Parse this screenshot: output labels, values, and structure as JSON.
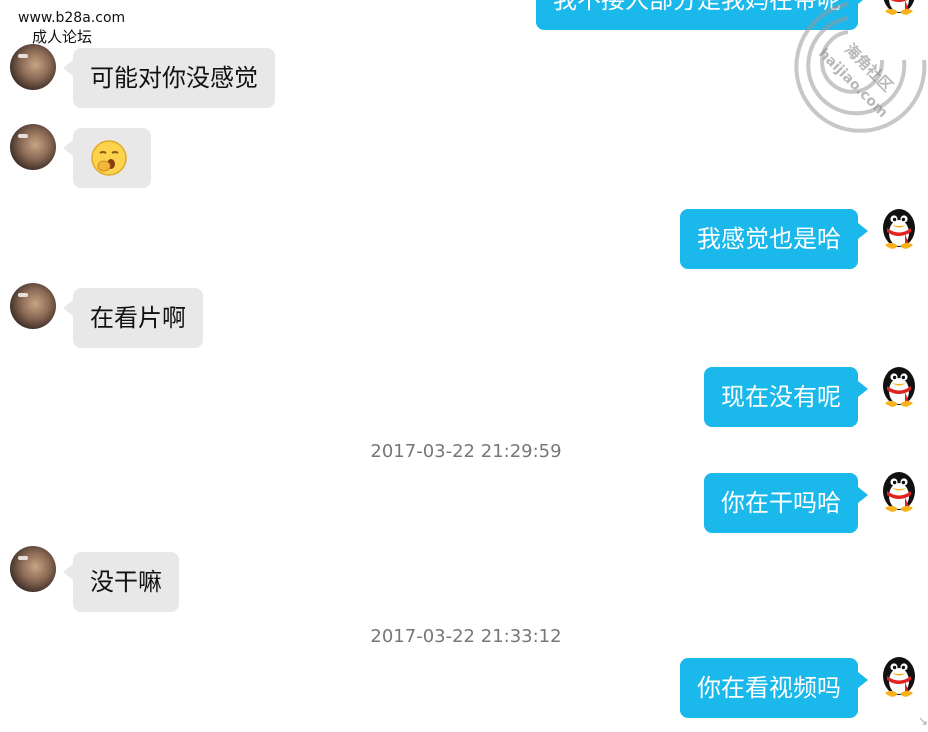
{
  "header": {
    "site_url": "www.b28a.com",
    "site_subtitle": "成人论坛"
  },
  "watermark": {
    "text_cn": "海角社区",
    "text_url": "haijiao.com"
  },
  "messages": [
    {
      "side": "right",
      "text": "我不接人部分是我妈在带呢"
    },
    {
      "side": "left",
      "text": "可能对你没感觉"
    },
    {
      "side": "left",
      "text": "",
      "emoji": "yawn-emoji"
    },
    {
      "side": "right",
      "text": "我感觉也是哈"
    },
    {
      "side": "left",
      "text": "在看片啊"
    },
    {
      "side": "right",
      "text": "现在没有呢"
    },
    {
      "side": "right",
      "text": "你在干吗哈"
    },
    {
      "side": "left",
      "text": "没干嘛"
    },
    {
      "side": "right",
      "text": "你在看视频吗"
    }
  ],
  "timestamps": [
    "2017-03-22 21:29:59",
    "2017-03-22 21:33:12"
  ],
  "colors": {
    "sent_bubble": "#1bb8ec",
    "received_bubble": "#e8e8e8",
    "timestamp_text": "#777777"
  },
  "icons": {
    "left_avatar": "contact-avatar",
    "right_avatar": "qq-penguin-avatar"
  }
}
